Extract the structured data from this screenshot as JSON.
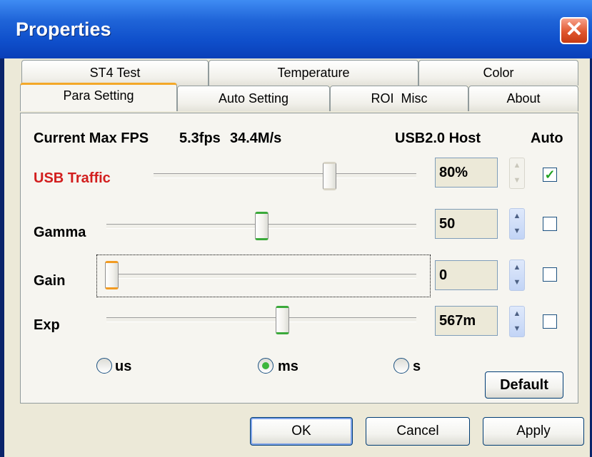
{
  "window": {
    "title": "Properties",
    "close_label": "✕"
  },
  "tabs": {
    "row1": [
      "ST4 Test",
      "Temperature",
      "Color"
    ],
    "row2": [
      "Para Setting",
      "Auto Setting",
      "ROI  Misc",
      "About"
    ]
  },
  "panel": {
    "max_fps_label": "Current Max FPS",
    "fps_value": "5.3fps",
    "bandwidth_value": "34.4M/s",
    "host_label": "USB2.0 Host",
    "auto_header": "Auto",
    "rows": [
      {
        "label": "USB Traffic",
        "value": "80%",
        "slider_level": 0.68,
        "auto_checked": true,
        "spin_enabled": false
      },
      {
        "label": "Gamma",
        "value": "50",
        "slider_level": 0.5,
        "auto_checked": false,
        "spin_enabled": true
      },
      {
        "label": "Gain",
        "value": "0",
        "slider_level": 0.0,
        "auto_checked": false,
        "spin_enabled": true
      },
      {
        "label": "Exp",
        "value": "567m",
        "slider_level": 0.57,
        "auto_checked": false,
        "spin_enabled": true
      }
    ],
    "units": [
      {
        "label": "us",
        "selected": false
      },
      {
        "label": "ms",
        "selected": true
      },
      {
        "label": "s",
        "selected": false
      }
    ],
    "default_button": "Default",
    "check_mark": "✓",
    "spin_up": "▲",
    "spin_down": "▼"
  },
  "buttons": {
    "ok": "OK",
    "cancel": "Cancel",
    "apply": "Apply"
  },
  "colors": {
    "title_bar": "#1f64d8",
    "usb_traffic_label": "#d21e1e",
    "check_green": "#21a121",
    "thumb_green": "#3aa93a",
    "thumb_orange": "#f29b22"
  }
}
